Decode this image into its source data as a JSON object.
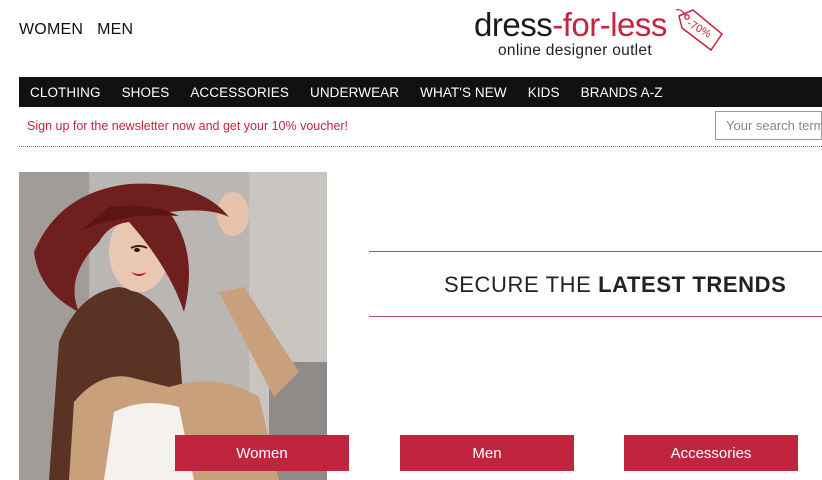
{
  "gender_nav": {
    "women": "WOMEN",
    "men": "MEN"
  },
  "logo": {
    "dress": "dress",
    "for_less": "-for-less",
    "tagline": "online designer outlet",
    "tag": "-70%"
  },
  "main_nav": [
    "CLOTHING",
    "SHOES",
    "ACCESSORIES",
    "UNDERWEAR",
    "WHAT'S NEW",
    "KIDS",
    "BRANDS A-Z"
  ],
  "newsletter": "Sign up for the newsletter now and get your 10% voucher!",
  "search": {
    "placeholder": "Your search term",
    "value": ""
  },
  "hero": {
    "title_light": "SECURE THE ",
    "title_bold": "LATEST TRENDS"
  },
  "categories": [
    "Women",
    "Men",
    "Accessories"
  ],
  "colors": {
    "brand_red": "#c0243f",
    "nav_bg": "#111111"
  }
}
